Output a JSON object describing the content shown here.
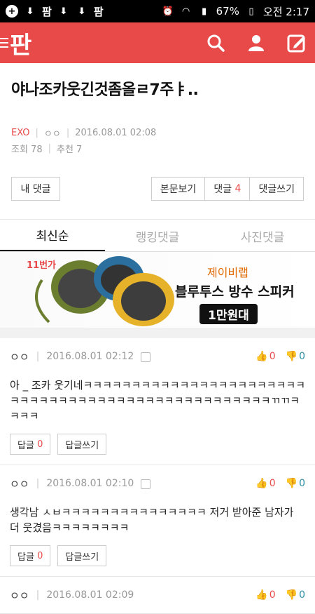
{
  "status": {
    "battery": "67%",
    "time": "오전 2:17",
    "pann_badge": "팜"
  },
  "appbar": {
    "logo": "판"
  },
  "post": {
    "title": "야나조카웃긴것좀올ㄹ7주ㅑ..",
    "category": "EXO",
    "author": "ㅇㅇ",
    "date": "2016.08.01 02:08",
    "views": "조회 78",
    "recommend": "추천 7"
  },
  "buttons": {
    "my_comments": "내 댓글",
    "view_original": "본문보기",
    "comments_label": "댓글",
    "comments_count": "4",
    "write_comment": "댓글쓰기"
  },
  "tabs": [
    {
      "label": "최신순",
      "active": true
    },
    {
      "label": "랭킹댓글",
      "active": false
    },
    {
      "label": "사진댓글",
      "active": false
    }
  ],
  "banner": {
    "badge": "11번가",
    "brand": "제이비랩",
    "title": "블루투스 방수 스피커",
    "price": "1만원대"
  },
  "comments": [
    {
      "author": "ㅇㅇ",
      "date": "2016.08.01 02:12",
      "up": "0",
      "down": "0",
      "body": "아 _ 조카 웃기네ㅋㅋㅋㅋㅋㅋㅋㅋㅋㅋㅋㅋㅋㅋㅋㅋㅋㅋㅋㅋㅋㅋㅋㅋㅋㅋㅋㅋㅋㅋㅋㅋㅋㅋㅋㅋㅋㅋㅋㅋㅋㅋㅋㅋㅋㅋㅋㅋㅋㅋㄲㄲㅋㅋㅋㅋ",
      "reply_label": "답글",
      "reply_count": "0",
      "write_reply": "답글쓰기"
    },
    {
      "author": "ㅇㅇ",
      "date": "2016.08.01 02:10",
      "up": "0",
      "down": "0",
      "body": "생각남 ㅅㅂㅋㅋㅋㅋㅋㅋㅋㅋㅋㅋㅋㅋㅋㅋㅋ 저거 받아준 남자가 더 웃겼음ㅋㅋㅋㅋㅋㅋㅋㅋ",
      "reply_label": "답글",
      "reply_count": "0",
      "write_reply": "답글쓰기"
    },
    {
      "author": "ㅇㅇ",
      "date": "2016.08.01 02:09",
      "up": "0",
      "down": "0"
    }
  ],
  "colors": {
    "brand": "#e84a4a",
    "thumb_down": "#2c8fa6"
  }
}
